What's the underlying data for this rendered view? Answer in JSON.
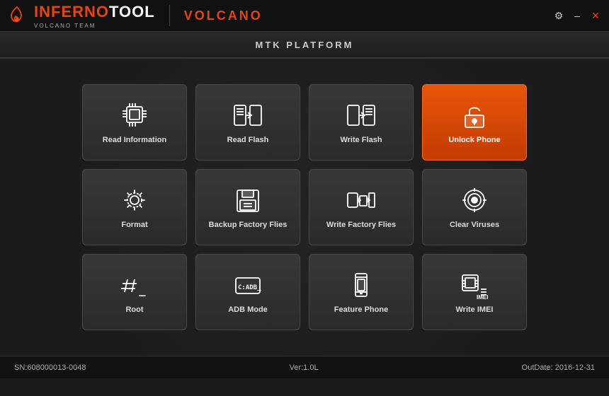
{
  "titlebar": {
    "logo_main": "INFERNO",
    "logo_highlight": "TOOL",
    "team_name": "VOLCANO TEAM",
    "product": "VOLCANO",
    "controls": {
      "settings": "⚙",
      "minimize": "–",
      "close": "✕"
    }
  },
  "platform": {
    "label": "MTK PLATFORM"
  },
  "grid": {
    "buttons": [
      {
        "id": "read-information",
        "label": "Read Information",
        "icon": "chip",
        "active": false
      },
      {
        "id": "read-flash",
        "label": "Read Flash",
        "icon": "flash-read",
        "active": false
      },
      {
        "id": "write-flash",
        "label": "Write Flash",
        "icon": "flash-write",
        "active": false
      },
      {
        "id": "unlock-phone",
        "label": "Unlock Phone",
        "icon": "lock-open",
        "active": true
      },
      {
        "id": "format",
        "label": "Format",
        "icon": "gear",
        "active": false
      },
      {
        "id": "backup-factory",
        "label": "Backup Factory Flies",
        "icon": "save",
        "active": false
      },
      {
        "id": "write-factory",
        "label": "Write Factory Flies",
        "icon": "factory-write",
        "active": false
      },
      {
        "id": "clear-viruses",
        "label": "Clear Viruses",
        "icon": "target",
        "active": false
      },
      {
        "id": "root",
        "label": "Root",
        "icon": "hash",
        "active": false
      },
      {
        "id": "adb-mode",
        "label": "ADB Mode",
        "icon": "adb",
        "active": false
      },
      {
        "id": "feature-phone",
        "label": "Feature Phone",
        "icon": "phone",
        "active": false
      },
      {
        "id": "write-imei",
        "label": "Write IMEI",
        "icon": "imei",
        "active": false
      }
    ]
  },
  "statusbar": {
    "sn": "SN:608000013-0048",
    "version": "Ver:1.0L",
    "outdate": "OutDate: 2016-12-31"
  }
}
